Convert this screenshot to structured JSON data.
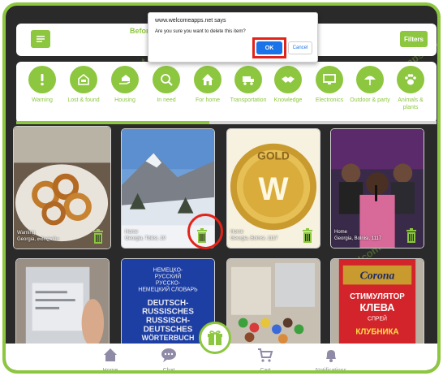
{
  "colors": {
    "accent": "#8dc63f",
    "highlight": "#e2231a",
    "nav_text": "#8f8ba6",
    "dialog_button": "#1a73e8"
  },
  "watermark": "WelcomeApps.net",
  "header": {
    "before_text": "Before",
    "filters_label": "Filters",
    "menu_icon": "menu-icon"
  },
  "categories": [
    {
      "label": "Warning",
      "icon": "exclamation-icon"
    },
    {
      "label": "Lost & found",
      "icon": "help-icon"
    },
    {
      "label": "Housing",
      "icon": "house-hand-icon"
    },
    {
      "label": "In need",
      "icon": "search-person-icon"
    },
    {
      "label": "For home",
      "icon": "home-icon"
    },
    {
      "label": "Transportation",
      "icon": "truck-icon"
    },
    {
      "label": "Knowledge",
      "icon": "handshake-icon"
    },
    {
      "label": "Electronics",
      "icon": "monitor-icon"
    },
    {
      "label": "Outdoor & party",
      "icon": "umbrella-icon"
    },
    {
      "label": "Animals & plants",
      "icon": "paw-icon"
    }
  ],
  "category_scroll_progress": 0.46,
  "cards": [
    {
      "category": "Warning",
      "location": "Georgia, თბილისი",
      "image": "onion-rings-photo"
    },
    {
      "category": "Home",
      "location": "Georgia, Tbilisi, 19",
      "image": "snowy-mountain-photo"
    },
    {
      "category": "Home",
      "location": "Georgia, Bolnisi, 1117",
      "image": "gold-w-medal"
    },
    {
      "category": "Home",
      "location": "Georgia, Bolnisi, 1117",
      "image": "speaker-photo"
    },
    {
      "category": "",
      "location": "",
      "image": "hard-drive-photo"
    },
    {
      "category": "",
      "location": "",
      "image": "dictionary-photo",
      "book_lines": [
        "НЕМЕЦКО-",
        "РУССКИЙ",
        "РУССКО-",
        "НЕМЕЦКИЙ СЛОВАРЬ",
        "DEUTSCH-",
        "RUSSISCHES",
        "RUSSISCH-",
        "DEUTSCHES",
        "WÖRTERBUCH"
      ]
    },
    {
      "category": "",
      "location": "",
      "image": "candy-bags-photo"
    },
    {
      "category": "",
      "location": "",
      "image": "corona-can-photo",
      "can_lines": [
        "Corona",
        "СТИМУЛЯТОР",
        "КЛЕВА",
        "СПРЕЙ",
        "КЛУБНИКА"
      ]
    }
  ],
  "medal_letter": "W",
  "medal_text": "GOLD",
  "nav": [
    {
      "label": "Home",
      "icon": "home-icon"
    },
    {
      "label": "Chat",
      "icon": "chat-icon"
    },
    {
      "label": "Cart",
      "icon": "cart-icon"
    },
    {
      "label": "Notifications",
      "icon": "bell-icon"
    }
  ],
  "gift_icon": "gift-icon",
  "dialog": {
    "title": "www.welcomeapps.net says",
    "message": "Are you sure you want to delete this item?",
    "ok_label": "OK",
    "cancel_label": "Cancel"
  }
}
